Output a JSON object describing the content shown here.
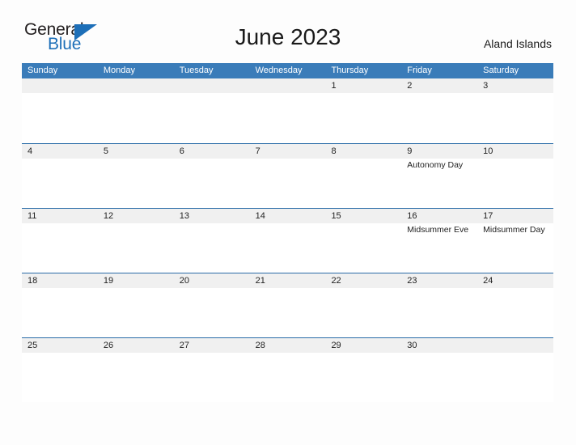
{
  "brand": {
    "name_part_1": "General",
    "name_part_2": "Blue",
    "triangle_color": "#1d6fb8",
    "text_color": "#231f20"
  },
  "header": {
    "title": "June 2023",
    "region": "Aland Islands"
  },
  "theme": {
    "header_blue": "#3a7cb9",
    "row_border_blue": "#2a6ca8",
    "day_band_gray": "#f0f0f0",
    "page_background": "#fdfdfd"
  },
  "calendar": {
    "weekdays": [
      "Sunday",
      "Monday",
      "Tuesday",
      "Wednesday",
      "Thursday",
      "Friday",
      "Saturday"
    ],
    "weeks": [
      [
        {
          "number": "",
          "events": []
        },
        {
          "number": "",
          "events": []
        },
        {
          "number": "",
          "events": []
        },
        {
          "number": "",
          "events": []
        },
        {
          "number": "1",
          "events": []
        },
        {
          "number": "2",
          "events": []
        },
        {
          "number": "3",
          "events": []
        }
      ],
      [
        {
          "number": "4",
          "events": []
        },
        {
          "number": "5",
          "events": []
        },
        {
          "number": "6",
          "events": []
        },
        {
          "number": "7",
          "events": []
        },
        {
          "number": "8",
          "events": []
        },
        {
          "number": "9",
          "events": [
            "Autonomy Day"
          ]
        },
        {
          "number": "10",
          "events": []
        }
      ],
      [
        {
          "number": "11",
          "events": []
        },
        {
          "number": "12",
          "events": []
        },
        {
          "number": "13",
          "events": []
        },
        {
          "number": "14",
          "events": []
        },
        {
          "number": "15",
          "events": []
        },
        {
          "number": "16",
          "events": [
            "Midsummer Eve"
          ]
        },
        {
          "number": "17",
          "events": [
            "Midsummer Day"
          ]
        }
      ],
      [
        {
          "number": "18",
          "events": []
        },
        {
          "number": "19",
          "events": []
        },
        {
          "number": "20",
          "events": []
        },
        {
          "number": "21",
          "events": []
        },
        {
          "number": "22",
          "events": []
        },
        {
          "number": "23",
          "events": []
        },
        {
          "number": "24",
          "events": []
        }
      ],
      [
        {
          "number": "25",
          "events": []
        },
        {
          "number": "26",
          "events": []
        },
        {
          "number": "27",
          "events": []
        },
        {
          "number": "28",
          "events": []
        },
        {
          "number": "29",
          "events": []
        },
        {
          "number": "30",
          "events": []
        },
        {
          "number": "",
          "events": []
        }
      ]
    ]
  }
}
